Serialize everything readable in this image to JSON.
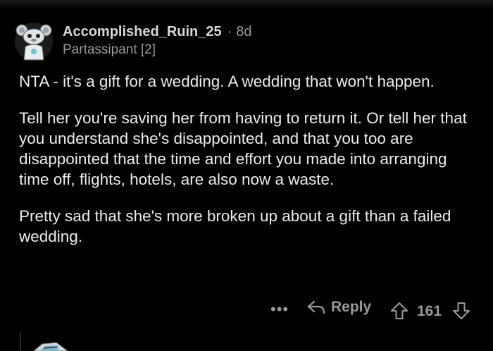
{
  "comment": {
    "username": "Accomplished_Ruin_25",
    "separator": "·",
    "time": "8d",
    "flair": "Partassipant [2]",
    "paragraphs": [
      "NTA - it's a gift for a wedding. A wedding that won't happen.",
      "Tell her you're saving her from having to return it.  Or tell her that you understand she's disappointed, and that you too are disappointed that the time and effort you made into arranging time off, flights, hotels, are also now a waste.",
      "Pretty sad that she's more broken up about a gift than a failed wedding."
    ]
  },
  "actions": {
    "more_label": "•••",
    "reply_label": "Reply",
    "score": "161"
  },
  "icons": {
    "more": "more-options-icon",
    "reply": "reply-arrow-icon",
    "upvote": "upvote-arrow-icon",
    "downvote": "downvote-arrow-icon",
    "avatar": "snoo-avatar"
  },
  "colors": {
    "background": "#000000",
    "text": "#ececec",
    "muted": "#9a9a9a"
  }
}
